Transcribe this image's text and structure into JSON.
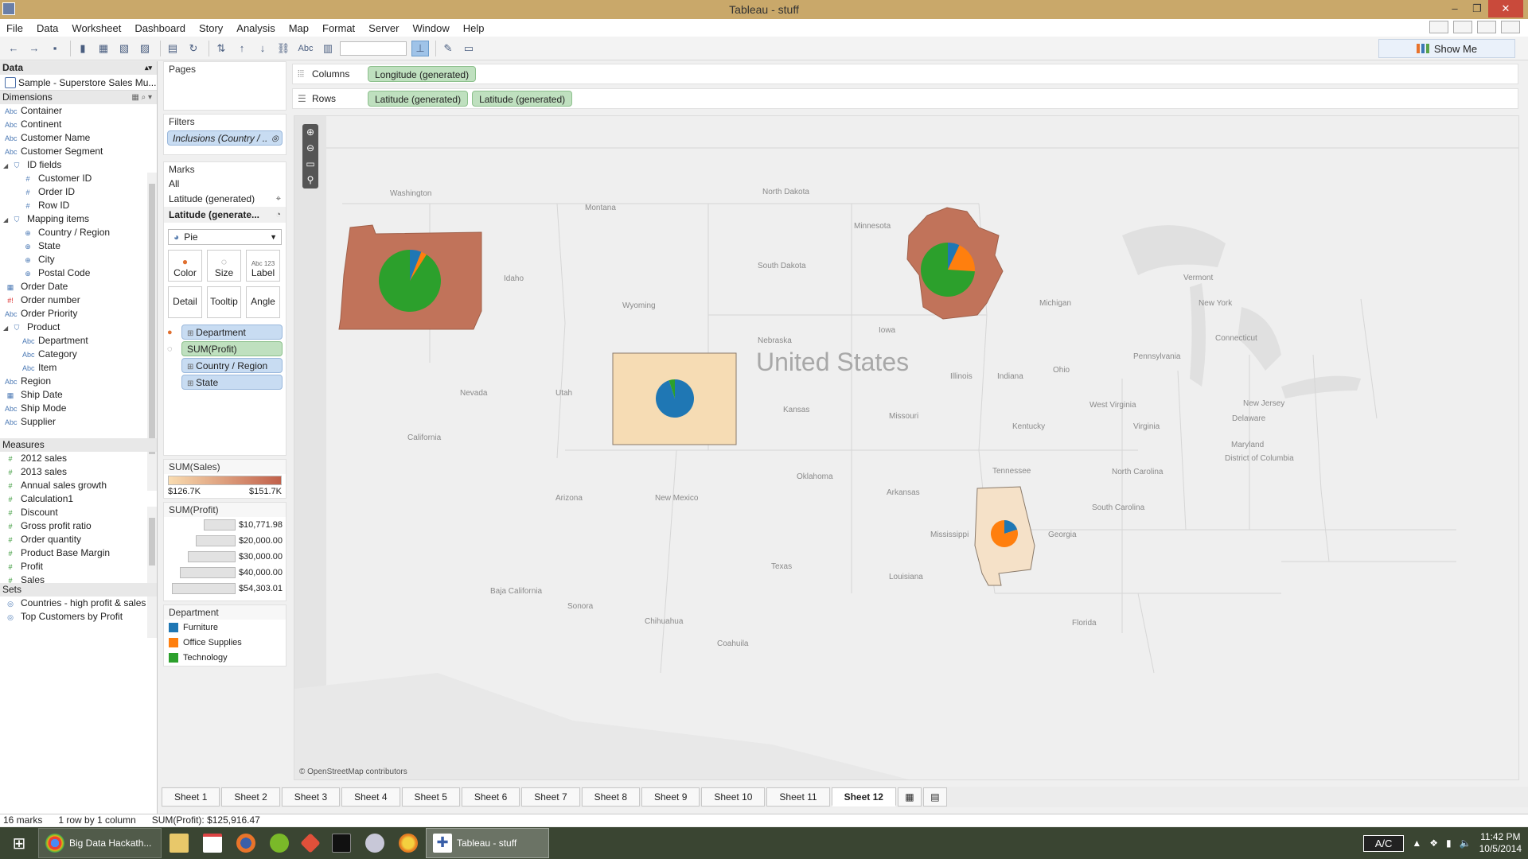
{
  "window": {
    "title": "Tableau - stuff"
  },
  "menu": [
    "File",
    "Data",
    "Worksheet",
    "Dashboard",
    "Story",
    "Analysis",
    "Map",
    "Format",
    "Server",
    "Window",
    "Help"
  ],
  "toolbar": {
    "abc_label": "Abc",
    "show_me": "Show Me"
  },
  "data_pane": {
    "title": "Data",
    "datasource": "Sample - Superstore Sales Mu...",
    "dimensions_label": "Dimensions",
    "dimensions": [
      {
        "label": "Container",
        "type": "Abc",
        "indent": 0
      },
      {
        "label": "Continent",
        "type": "Abc",
        "indent": 0
      },
      {
        "label": "Customer Name",
        "type": "Abc",
        "indent": 0
      },
      {
        "label": "Customer Segment",
        "type": "Abc",
        "indent": 0
      },
      {
        "label": "ID fields",
        "type": "folder",
        "indent": 0
      },
      {
        "label": "Customer ID",
        "type": "#",
        "indent": 1
      },
      {
        "label": "Order ID",
        "type": "#",
        "indent": 1
      },
      {
        "label": "Row ID",
        "type": "#",
        "indent": 1
      },
      {
        "label": "Mapping items",
        "type": "folder",
        "indent": 0
      },
      {
        "label": "Country / Region",
        "type": "geo",
        "indent": 1
      },
      {
        "label": "State",
        "type": "geo",
        "indent": 1
      },
      {
        "label": "City",
        "type": "geo",
        "indent": 1
      },
      {
        "label": "Postal Code",
        "type": "geo",
        "indent": 1
      },
      {
        "label": "Order Date",
        "type": "date",
        "indent": 0
      },
      {
        "label": "Order number",
        "type": "#!",
        "indent": 0
      },
      {
        "label": "Order Priority",
        "type": "Abc",
        "indent": 0
      },
      {
        "label": "Product",
        "type": "folder",
        "indent": 0
      },
      {
        "label": "Department",
        "type": "Abc",
        "indent": 1
      },
      {
        "label": "Category",
        "type": "Abc",
        "indent": 1
      },
      {
        "label": "Item",
        "type": "Abc",
        "indent": 1
      },
      {
        "label": "Region",
        "type": "Abc",
        "indent": 0
      },
      {
        "label": "Ship Date",
        "type": "date",
        "indent": 0
      },
      {
        "label": "Ship Mode",
        "type": "Abc",
        "indent": 0
      },
      {
        "label": "Supplier",
        "type": "Abc",
        "indent": 0
      }
    ],
    "measures_label": "Measures",
    "measures": [
      "2012 sales",
      "2013 sales",
      "Annual sales growth",
      "Calculation1",
      "Discount",
      "Gross profit ratio",
      "Order quantity",
      "Product Base Margin",
      "Profit",
      "Sales"
    ],
    "sets_label": "Sets",
    "sets": [
      "Countries - high profit & sales",
      "Top Customers by Profit"
    ]
  },
  "pages": {
    "title": "Pages"
  },
  "filters": {
    "title": "Filters",
    "pill": "Inclusions (Country / .."
  },
  "marks": {
    "title": "Marks",
    "all": "All",
    "layer1": "Latitude (generated)",
    "layer2": "Latitude (generate...",
    "mark_type": "Pie",
    "buttons": [
      "Color",
      "Size",
      "Label",
      "Detail",
      "Tooltip",
      "Angle"
    ],
    "label_btn_icon": "Abc 123",
    "pills": [
      {
        "label": "Department",
        "color": "blue"
      },
      {
        "label": "SUM(Profit)",
        "color": "green"
      },
      {
        "label": "Country / Region",
        "color": "blue"
      },
      {
        "label": "State",
        "color": "blue"
      }
    ]
  },
  "legend_sales": {
    "title": "SUM(Sales)",
    "min": "$126.7K",
    "max": "$151.7K"
  },
  "legend_profit": {
    "title": "SUM(Profit)",
    "values": [
      "$10,771.98",
      "$20,000.00",
      "$30,000.00",
      "$40,000.00",
      "$54,303.01"
    ]
  },
  "legend_department": {
    "title": "Department",
    "items": [
      {
        "label": "Furniture",
        "color": "#1f77b4"
      },
      {
        "label": "Office Supplies",
        "color": "#ff7f0e"
      },
      {
        "label": "Technology",
        "color": "#2ca02c"
      }
    ]
  },
  "columns_shelf": {
    "label": "Columns",
    "pills": [
      "Longitude (generated)"
    ]
  },
  "rows_shelf": {
    "label": "Rows",
    "pills": [
      "Latitude (generated)",
      "Latitude (generated)"
    ]
  },
  "map": {
    "country_label": "United States",
    "attribution": "© OpenStreetMap contributors",
    "place_labels": [
      "Washington",
      "Montana",
      "North Dakota",
      "Minnesota",
      "Idaho",
      "South Dakota",
      "Wyoming",
      "Nebraska",
      "Iowa",
      "Michigan",
      "Nevada",
      "Utah",
      "California",
      "Kansas",
      "Missouri",
      "Illinois",
      "Indiana",
      "Ohio",
      "Pennsylvania",
      "Vermont",
      "New York",
      "Connecticut",
      "New Jersey",
      "Delaware",
      "Maryland",
      "District of Columbia",
      "West Virginia",
      "Virginia",
      "Kentucky",
      "Tennessee",
      "North Carolina",
      "South Carolina",
      "Georgia",
      "Oklahoma",
      "Arkansas",
      "Arizona",
      "New Mexico",
      "Texas",
      "Mississippi",
      "Louisiana",
      "Florida",
      "Baja California",
      "Sonora",
      "Chihuahua",
      "Coahuila"
    ],
    "highlighted_states": [
      {
        "state": "Oregon",
        "fill": "#c1735a",
        "pie": {
          "Furniture": 0.06,
          "Office Supplies": 0.03,
          "Technology": 0.91
        }
      },
      {
        "state": "Wisconsin",
        "fill": "#c1735a",
        "pie": {
          "Furniture": 0.07,
          "Office Supplies": 0.19,
          "Technology": 0.74
        }
      },
      {
        "state": "Colorado",
        "fill": "#f6dcb4",
        "pie": {
          "Furniture": 0.95,
          "Office Supplies": 0.0,
          "Technology": 0.05
        }
      },
      {
        "state": "Alabama",
        "fill": "#f5e1c8",
        "pie": {
          "Furniture": 0.2,
          "Office Supplies": 0.8,
          "Technology": 0.0
        }
      }
    ]
  },
  "sheets": [
    "Sheet 1",
    "Sheet 2",
    "Sheet 3",
    "Sheet 4",
    "Sheet 5",
    "Sheet 6",
    "Sheet 7",
    "Sheet 8",
    "Sheet 9",
    "Sheet 10",
    "Sheet 11",
    "Sheet 12"
  ],
  "active_sheet": "Sheet 12",
  "status": {
    "marks": "16 marks",
    "dims": "1 row by 1 column",
    "sum": "SUM(Profit): $125,916.47"
  },
  "taskbar": {
    "tasks": [
      "Big Data Hackath...",
      "Tableau - stuff"
    ],
    "ac": "A/C",
    "time": "11:42 PM",
    "date": "10/5/2014"
  }
}
